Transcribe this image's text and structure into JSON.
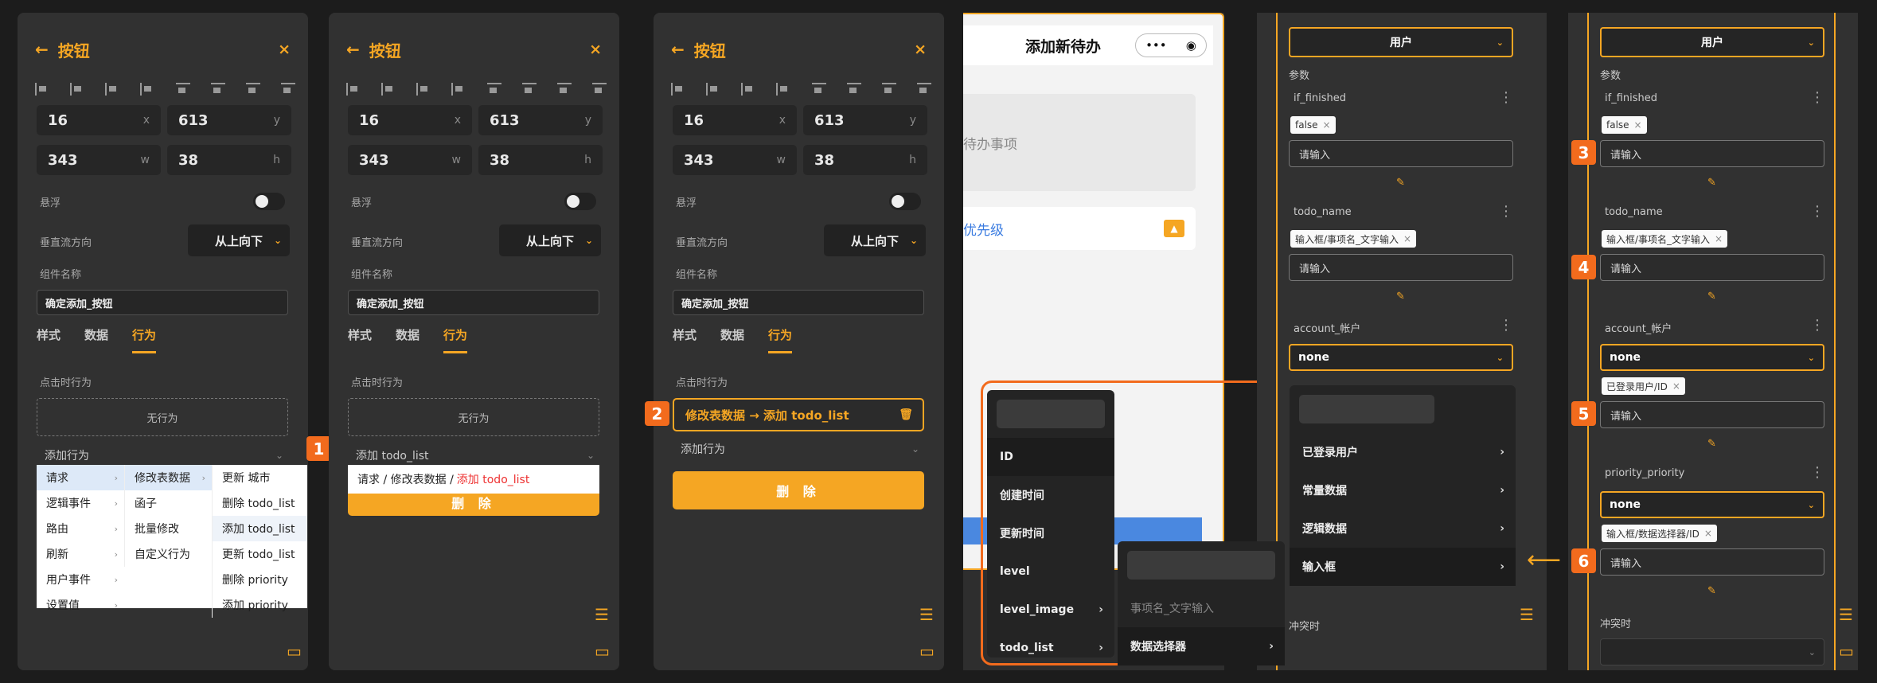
{
  "header": {
    "back_icon": "arrow-left-icon",
    "title": "按钮",
    "close_icon": "close-icon"
  },
  "geometry": {
    "x": "16",
    "x_unit": "x",
    "y": "613",
    "y_unit": "y",
    "w": "343",
    "w_unit": "w",
    "h": "38",
    "h_unit": "h"
  },
  "props": {
    "float_label": "悬浮",
    "flow_label": "垂直流方向",
    "flow_value": "从上向下",
    "name_label": "组件名称",
    "name_value": "确定添加_按钮"
  },
  "tabs": [
    "样式",
    "数据",
    "行为"
  ],
  "behavior": {
    "click_label": "点击时行为",
    "no_action": "无行为",
    "add_action": "添加行为",
    "add_todo": "添加 todo_list",
    "breadcrumb_a": "请求 / 修改表数据 / ",
    "breadcrumb_b": "添加 todo_list",
    "action_item": "修改表数据 → 添加 todo_list",
    "delete_btn": "删 除"
  },
  "menu1": {
    "col1": [
      "请求",
      "逻辑事件",
      "路由",
      "刷新",
      "用户事件",
      "设置值"
    ],
    "col2": [
      "修改表数据",
      "函子",
      "批量修改",
      "自定义行为"
    ],
    "col3": [
      "更新 城市",
      "删除 todo_list",
      "添加 todo_list",
      "更新 todo_list",
      "删除 priority",
      "添加 priority"
    ]
  },
  "badges": [
    "1",
    "2",
    "3",
    "4",
    "5",
    "6"
  ],
  "phone": {
    "title": "添加新待办",
    "more_icon": "more-icon",
    "record_icon": "record-icon",
    "placeholder": "待办事项",
    "priority": "优先级",
    "image_icon": "image-icon"
  },
  "menu_fields": [
    "ID",
    "创建时间",
    "更新时间",
    "level",
    "level_image",
    "todo_list"
  ],
  "menu_sub": {
    "hint": "事项名_文字输入",
    "item": "数据选择器"
  },
  "menu_source": [
    "已登录用户",
    "常量数据",
    "逻辑数据",
    "输入框"
  ],
  "param_panel": {
    "user": "用户",
    "params": "参数",
    "p1": "if_finished",
    "p1_tag": "false",
    "input_ph": "请输入",
    "p2": "todo_name",
    "p2_tag": "输入框/事项名_文字输入",
    "p3": "account_帐户",
    "p3_val": "none",
    "p3_tag": "已登录用户/ID",
    "p4": "priority_priority",
    "p4_val": "none",
    "p4_tag": "输入框/数据选择器/ID",
    "conflict": "冲突时"
  },
  "colors": {
    "accent": "#f5a623",
    "badge": "#f26b1d",
    "panel": "#313131",
    "bg": "#1c1c1c"
  }
}
